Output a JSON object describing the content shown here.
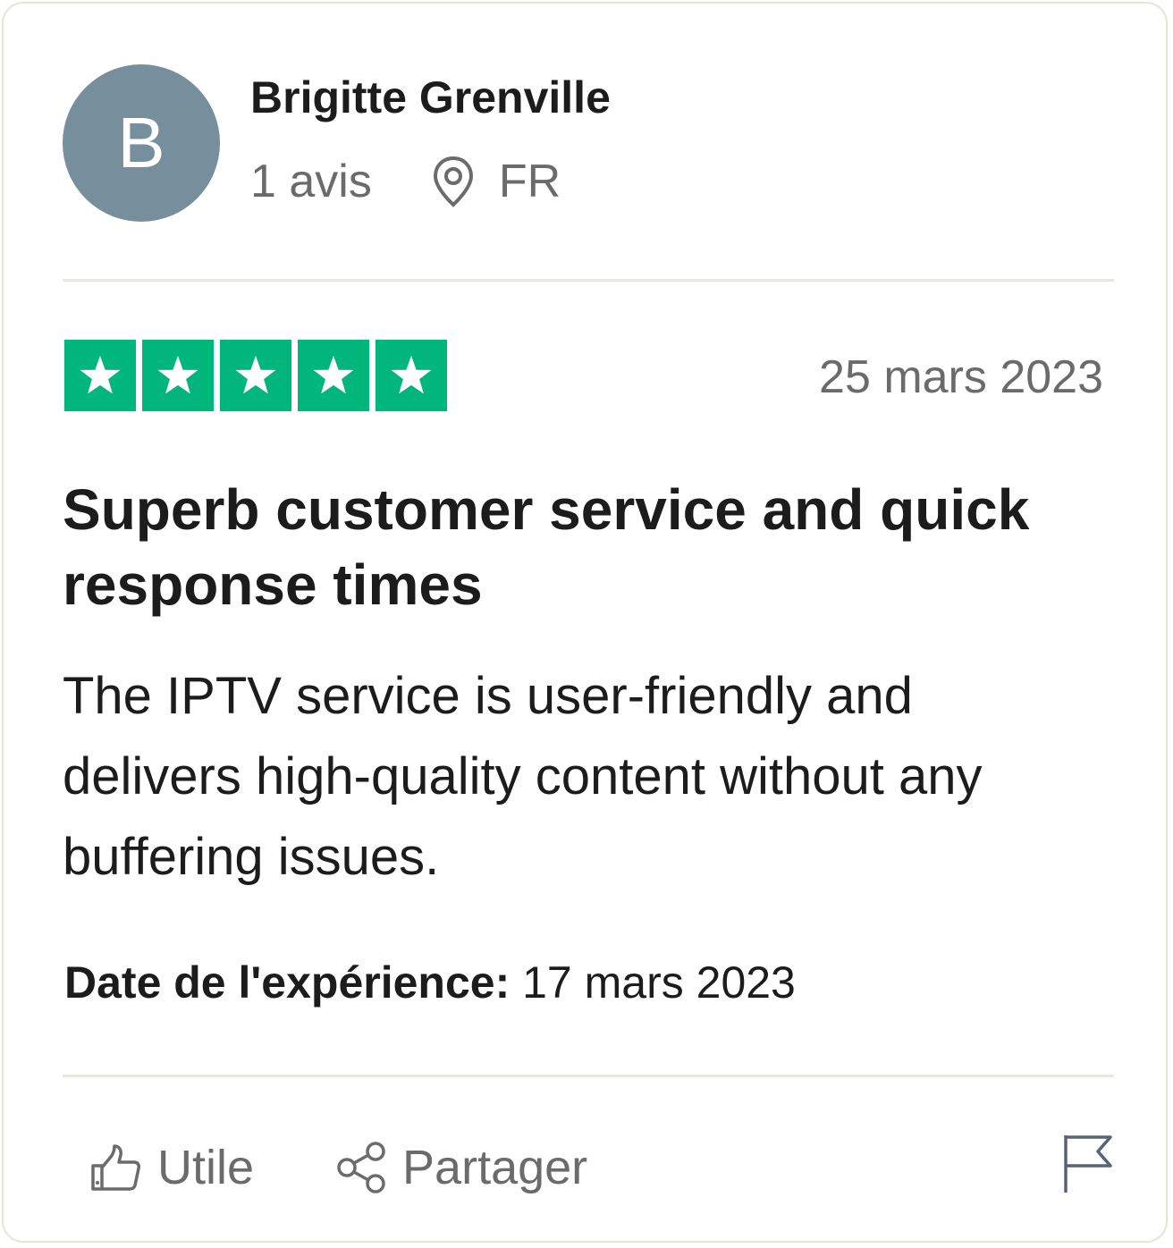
{
  "reviewer": {
    "initial": "B",
    "name": "Brigitte Grenville",
    "review_count": "1 avis",
    "country": "FR"
  },
  "review": {
    "rating": 5,
    "date": "25 mars 2023",
    "title": "Superb customer service and quick response times",
    "body": "The IPTV service is user-friendly and delivers high-quality content without any buffering issues.",
    "experience_label": "Date de l'expérience:",
    "experience_date": "17 mars 2023"
  },
  "actions": {
    "useful_label": "Utile",
    "share_label": "Partager"
  },
  "colors": {
    "star_green": "#00b67a",
    "avatar_bg": "#778e9c",
    "icon_gray": "#6b6b6b",
    "flag_gray": "#5b6275"
  },
  "icons": [
    "location-pin-icon",
    "star-icon",
    "thumbs-up-icon",
    "share-icon",
    "flag-icon"
  ]
}
